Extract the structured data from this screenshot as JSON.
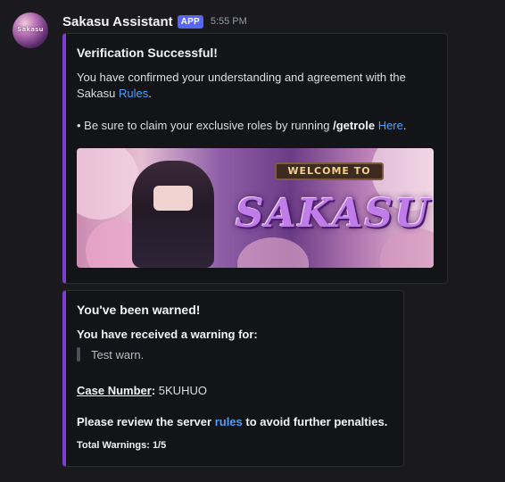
{
  "message": {
    "avatar_text": "Sakasu",
    "username": "Sakasu Assistant",
    "badge": "APP",
    "timestamp": "5:55 PM"
  },
  "embed1": {
    "accent_color": "#7a3fd1",
    "title": "Verification Successful!",
    "line1": "You have confirmed your understanding and agreement with the",
    "line2_prefix": "Sakasu",
    "line2_link": "Rules",
    "line2_suffix": ".",
    "bullet_prefix": "• Be sure to claim your exclusive roles by running",
    "bullet_command": "/getrole",
    "bullet_link": "Here",
    "bullet_suffix": ".",
    "banner": {
      "welcome_text": "WELCOME TO",
      "brand_text": "SAKASU"
    }
  },
  "embed2": {
    "accent_color": "#7a3fd1",
    "title": "You've been warned!",
    "warning_label": "You have received a warning for:",
    "warning_reason": "Test warn.",
    "case_label": "Case Number",
    "case_sep": ":",
    "case_value": "5KUHUO",
    "review_prefix": "Please review the server",
    "review_link": "rules",
    "review_suffix": "to avoid further penalties.",
    "total_warnings": "Total Warnings: 1/5"
  }
}
